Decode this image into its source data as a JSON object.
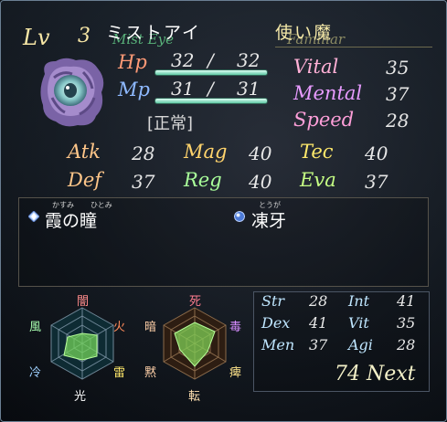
{
  "level": {
    "label": "Lv",
    "value": "3"
  },
  "name": {
    "jp": "ミストアイ",
    "en": "Mist Eye"
  },
  "role": {
    "jp": "使い魔",
    "en": "Familiar"
  },
  "portrait_icon": "mist-eye-portrait",
  "hp": {
    "label": "Hp",
    "current": "32",
    "sep": "/",
    "max": "32"
  },
  "mp": {
    "label": "Mp",
    "current": "31",
    "sep": "/",
    "max": "31"
  },
  "status": "[正常]",
  "vitals": [
    {
      "label": "Vital",
      "value": "35"
    },
    {
      "label": "Mental",
      "value": "37"
    },
    {
      "label": "Speed",
      "value": "28"
    }
  ],
  "params": [
    {
      "label": "Atk",
      "value": "28"
    },
    {
      "label": "Mag",
      "value": "40"
    },
    {
      "label": "Tec",
      "value": "40"
    },
    {
      "label": "Def",
      "value": "37"
    },
    {
      "label": "Reg",
      "value": "40"
    },
    {
      "label": "Eva",
      "value": "37"
    }
  ],
  "skills": [
    {
      "name": "霞の瞳",
      "ruby1": "かすみ",
      "ruby2": "ひとみ",
      "icon": "diamond-gem-icon"
    },
    {
      "name": "凍牙",
      "ruby1": "とうが",
      "ruby2": "",
      "icon": "blue-orb-icon"
    }
  ],
  "elements_left": {
    "top": "闇",
    "upper_right": "火",
    "lower_right": "雷",
    "bottom": "光",
    "lower_left": "冷",
    "upper_left": "風"
  },
  "elements_right": {
    "top": "死",
    "upper_right": "毒",
    "lower_right": "痺",
    "bottom": "転",
    "lower_left": "黙",
    "upper_left": "暗"
  },
  "attributes": [
    {
      "label": "Str",
      "value": "28"
    },
    {
      "label": "Int",
      "value": "41"
    },
    {
      "label": "Dex",
      "value": "41"
    },
    {
      "label": "Vit",
      "value": "35"
    },
    {
      "label": "Men",
      "value": "37"
    },
    {
      "label": "Agi",
      "value": "28"
    }
  ],
  "next_exp": "74 Next",
  "colors": {
    "hp": "#ff9a76",
    "mp": "#8eb9ff",
    "bar": "#5ec7a3"
  }
}
